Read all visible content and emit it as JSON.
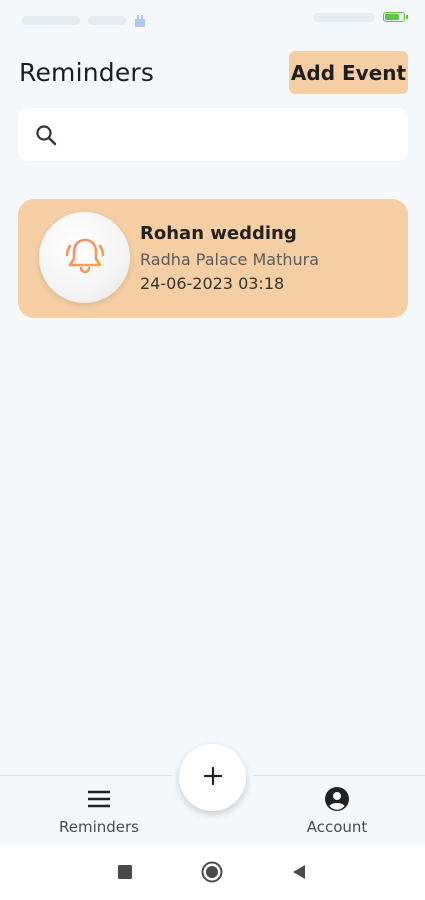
{
  "header": {
    "title": "Reminders",
    "add_event_label": "Add Event"
  },
  "search": {
    "placeholder": "",
    "value": ""
  },
  "events": [
    {
      "title": "Rohan wedding",
      "location": "Radha Palace Mathura",
      "datetime": "24-06-2023 03:18",
      "icon": "bell-icon"
    }
  ],
  "bottom_nav": {
    "items": [
      {
        "label": "Reminders",
        "icon": "menu-icon"
      },
      {
        "label": "Account",
        "icon": "account-icon"
      }
    ],
    "fab_icon": "plus-icon"
  },
  "colors": {
    "accent": "#f5cfa3",
    "background": "#f4f8fb",
    "bell_gradient_start": "#f08a7a",
    "bell_gradient_end": "#f4a640",
    "battery": "#5dc840"
  },
  "status_bar": {
    "battery_level": 0.85
  }
}
